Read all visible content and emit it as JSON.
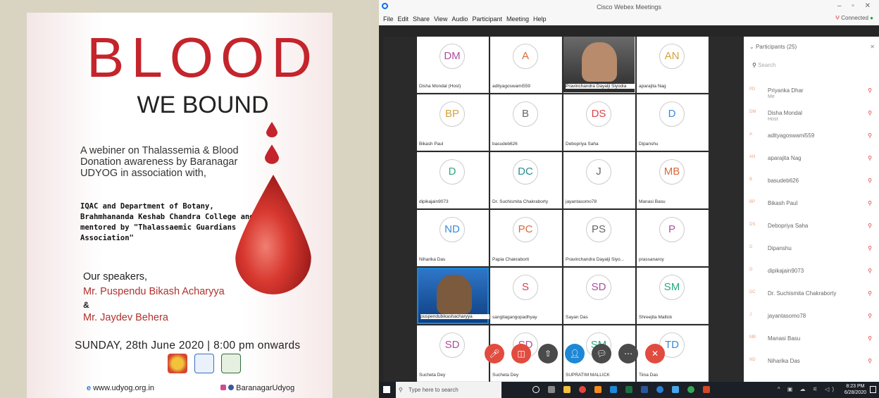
{
  "poster": {
    "title": "BLOOD",
    "subtitle": "WE BOUND",
    "body": "A webiner on Thalassemia & Blood Donation awareness by Baranagar UDYOG in association with,",
    "partners": "IQAC and Department of Botany, Brahmhananda Keshab Chandra College and mentored by \"Thalassaemic Guardians Association\"",
    "speakers_label": "Our speakers,",
    "speaker1": "Mr. Puspendu Bikash Acharyya",
    "amp": "&",
    "speaker2": "Mr. Jaydev Behera",
    "date": "SUNDAY, 28th June 2020 | 8:00 pm onwards",
    "website": "www.udyog.org.in",
    "social": "BaranagarUdyog",
    "accent": "#c4242b"
  },
  "webex": {
    "window_title": "Cisco Webex Meetings",
    "menu": [
      "File",
      "Edit",
      "Share",
      "View",
      "Audio",
      "Participant",
      "Meeting",
      "Help"
    ],
    "connected_label": "Connected",
    "tiles": [
      {
        "initials": "DM",
        "name": "Disha Mondal (Host)",
        "color": "#b04d9e",
        "type": "avatar"
      },
      {
        "initials": "A",
        "name": "adityagoswami559",
        "color": "#d86a3a",
        "type": "avatar"
      },
      {
        "initials": "",
        "name": "Pravinchandra Dayalji Siyodia",
        "color": "#555",
        "type": "video"
      },
      {
        "initials": "AN",
        "name": "aparajita Nag",
        "color": "#d4a33a",
        "type": "avatar"
      },
      {
        "initials": "BP",
        "name": "Bikash Paul",
        "color": "#d4a33a",
        "type": "avatar"
      },
      {
        "initials": "B",
        "name": "basudeb626",
        "color": "#666",
        "type": "avatar"
      },
      {
        "initials": "DS",
        "name": "Debopriya Saha",
        "color": "#d8434a",
        "type": "avatar"
      },
      {
        "initials": "D",
        "name": "Dipanshu",
        "color": "#3a8ad8",
        "type": "avatar"
      },
      {
        "initials": "D",
        "name": "dipikajain9073",
        "color": "#2ba87b",
        "type": "avatar"
      },
      {
        "initials": "DC",
        "name": "Dr. Suchismita Chakraborty",
        "color": "#2a8c8c",
        "type": "avatar"
      },
      {
        "initials": "J",
        "name": "jayantasomo78",
        "color": "#666",
        "type": "avatar"
      },
      {
        "initials": "MB",
        "name": "Manasi Basu",
        "color": "#d86a3a",
        "type": "avatar"
      },
      {
        "initials": "ND",
        "name": "Niharika Das",
        "color": "#3a8ad8",
        "type": "avatar"
      },
      {
        "initials": "PC",
        "name": "Papia Chakraborti",
        "color": "#d86a3a",
        "type": "avatar"
      },
      {
        "initials": "PS",
        "name": "Pravinchandra Dayalji Siyo...",
        "color": "#666",
        "type": "avatar"
      },
      {
        "initials": "P",
        "name": "prassanaroy",
        "color": "#b04d9e",
        "type": "avatar"
      },
      {
        "initials": "",
        "name": "puspendubikashacharyya",
        "color": "#555",
        "type": "video"
      },
      {
        "initials": "S",
        "name": "sangitagangopadhyay",
        "color": "#d8434a",
        "type": "avatar"
      },
      {
        "initials": "SD",
        "name": "Sayan Das",
        "color": "#b04d9e",
        "type": "avatar"
      },
      {
        "initials": "SM",
        "name": "Shreejita Mallick",
        "color": "#2ba87b",
        "type": "avatar"
      },
      {
        "initials": "SD",
        "name": "Sucheta Dey",
        "color": "#b04d9e",
        "type": "avatar"
      },
      {
        "initials": "SD",
        "name": "Sucheta Dey",
        "color": "#b04d9e",
        "type": "avatar"
      },
      {
        "initials": "SM",
        "name": "SUPRATIM MALLICK",
        "color": "#2ba87b",
        "type": "avatar"
      },
      {
        "initials": "TD",
        "name": "Tiina Das",
        "color": "#3a8ad8",
        "type": "avatar"
      }
    ],
    "participants_header": "Participants (25)",
    "search_placeholder": "Search",
    "participants": [
      {
        "initials": "PD",
        "name": "Priyanka Dhar",
        "sub": "Me"
      },
      {
        "initials": "DM",
        "name": "Disha Mondal",
        "sub": "Host"
      },
      {
        "initials": "A",
        "name": "adityagoswami559",
        "sub": ""
      },
      {
        "initials": "AN",
        "name": "aparajita Nag",
        "sub": ""
      },
      {
        "initials": "B",
        "name": "basudeb626",
        "sub": ""
      },
      {
        "initials": "BP",
        "name": "Bikash Paul",
        "sub": ""
      },
      {
        "initials": "DS",
        "name": "Debopriya Saha",
        "sub": ""
      },
      {
        "initials": "D",
        "name": "Dipanshu",
        "sub": ""
      },
      {
        "initials": "D",
        "name": "dipikajain9073",
        "sub": ""
      },
      {
        "initials": "DC",
        "name": "Dr. Suchismita Chakraborty",
        "sub": ""
      },
      {
        "initials": "J",
        "name": "jayantasomo78",
        "sub": ""
      },
      {
        "initials": "MB",
        "name": "Manasi Basu",
        "sub": ""
      },
      {
        "initials": "ND",
        "name": "Niharika Das",
        "sub": ""
      }
    ],
    "taskbar": {
      "search": "Type here to search",
      "time": "8:23 PM",
      "date": "6/28/2020"
    }
  }
}
